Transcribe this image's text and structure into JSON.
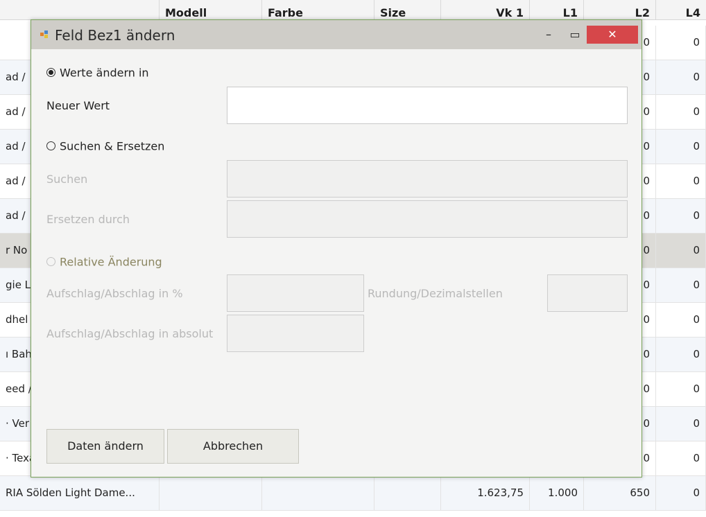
{
  "grid": {
    "headers": [
      {
        "label": ""
      },
      {
        "label": "Modell"
      },
      {
        "label": "Farbe"
      },
      {
        "label": "Size"
      },
      {
        "label": "Vk 1"
      },
      {
        "label": "L1"
      },
      {
        "label": "L2"
      },
      {
        "label": "L4"
      }
    ],
    "rows": [
      {
        "name": "",
        "vk1": "",
        "l1": "",
        "l2": "0",
        "l4": "0"
      },
      {
        "name": "ad /",
        "vk1": "",
        "l1": "",
        "l2": "0",
        "l4": "0"
      },
      {
        "name": "ad /",
        "vk1": "",
        "l1": "",
        "l2": "0",
        "l4": "0"
      },
      {
        "name": "ad /",
        "vk1": "",
        "l1": "",
        "l2": "0",
        "l4": "0"
      },
      {
        "name": "ad /",
        "vk1": "",
        "l1": "",
        "l2": "0",
        "l4": "0"
      },
      {
        "name": "ad /",
        "vk1": "",
        "l1": "",
        "l2": "0",
        "l4": "0"
      },
      {
        "name": "r No",
        "vk1": "",
        "l1": "",
        "l2": "0",
        "l4": "0"
      },
      {
        "name": "gie L",
        "vk1": "",
        "l1": "",
        "l2": "0",
        "l4": "0"
      },
      {
        "name": "dhel",
        "vk1": "",
        "l1": "",
        "l2": "0",
        "l4": "0"
      },
      {
        "name": "ı Bah",
        "vk1": "",
        "l1": "",
        "l2": "0",
        "l4": "0"
      },
      {
        "name": "eed /",
        "vk1": "",
        "l1": "",
        "l2": "0",
        "l4": "0"
      },
      {
        "name": "· Ver",
        "vk1": "",
        "l1": "",
        "l2": "0",
        "l4": "0"
      },
      {
        "name": "· Texa",
        "vk1": "",
        "l1": "",
        "l2": "0",
        "l4": "0"
      },
      {
        "name": "RIA Sölden Light Dame...",
        "vk1": "1.623,75",
        "l1": "1.000",
        "l2": "650",
        "l4": "0"
      }
    ]
  },
  "dialog": {
    "title": "Feld Bez1 ändern",
    "window_min": "–",
    "window_max": "▭",
    "window_close": "✕",
    "radio_werte": "Werte ändern in",
    "label_neuer_wert": "Neuer Wert",
    "neuer_wert_value": "",
    "radio_suchen": "Suchen & Ersetzen",
    "label_suchen": "Suchen",
    "suchen_value": "",
    "label_ersetzen": "Ersetzen durch",
    "ersetzen_value": "",
    "radio_relativ": "Relative Änderung",
    "label_aufschlag_prozent": "Aufschlag/Abschlag in %",
    "aufschlag_prozent_value": "",
    "label_rundung": "Rundung/Dezimalstellen",
    "rundung_value": "",
    "label_aufschlag_absolut": "Aufschlag/Abschlag in absolut",
    "aufschlag_absolut_value": "",
    "btn_daten_aendern": "Daten ändern",
    "btn_abbrechen": "Abbrechen"
  },
  "colors": {
    "titlebar": "#cfcdc8",
    "close_button": "#d6474a",
    "dialog_border": "#7aa35b",
    "selected_row": "#dcdbd7",
    "disabled_text": "#b8b8b8",
    "relativ_label": "#8a8560"
  }
}
